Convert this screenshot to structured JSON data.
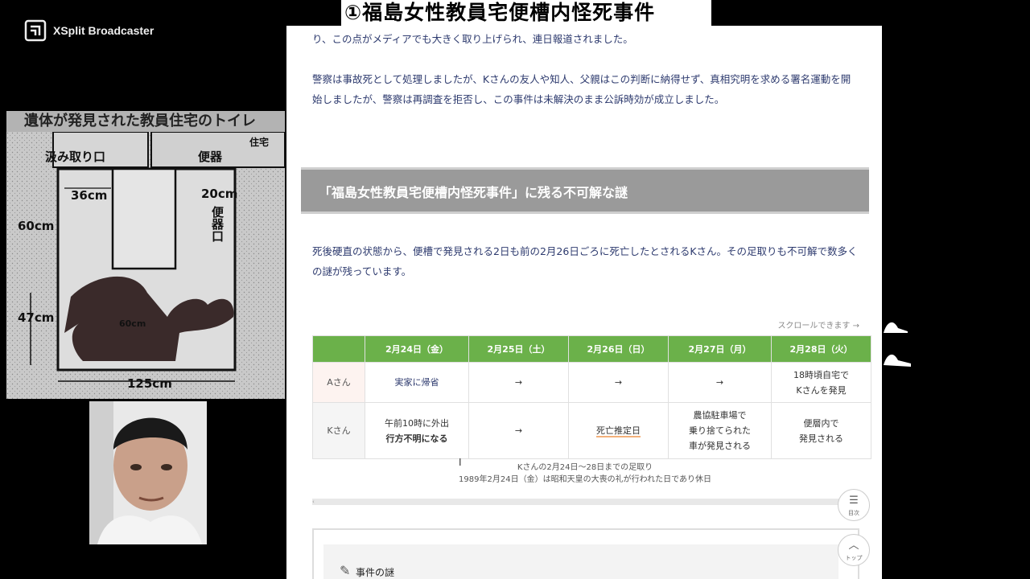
{
  "banner": {
    "title": "①福島女性教員宅便槽内怪死事件"
  },
  "xsplit": {
    "name": "XSplit Broadcaster"
  },
  "plan": {
    "header": "遺体が発見された教員住宅のトイレ",
    "labels": {
      "kumitori": "汲み取り口",
      "benki": "便器",
      "jutaku": "住宅",
      "w36": "36cm",
      "w20": "20cm",
      "benkiguchi": "便器口",
      "h60": "60cm",
      "h47": "47cm",
      "w125": "125cm",
      "w60": "60cm"
    }
  },
  "page": {
    "para1": "り、この点がメディアでも大きく取り上げられ、連日報道されました。",
    "para2": "警察は事故死として処理しましたが、Kさんの友人や知人、父親はこの判断に納得せず、真相究明を求める署名運動を開始しましたが、警察は再調査を拒否し、この事件は未解決のまま公訴時効が成立しました。",
    "heading": "「福島女性教員宅便槽内怪死事件」に残る不可解な謎",
    "para3": "死後硬直の状態から、便槽で発見される2日も前の2月26日ごろに死亡したとされるKさん。その足取りも不可解で数多くの謎が残っています。",
    "scroll_hint": "スクロールできます →",
    "table": {
      "headers": [
        "",
        "2月24日（金）",
        "2月25日（土）",
        "2月26日（日）",
        "2月27日（月）",
        "2月28日（火）"
      ],
      "rows": [
        {
          "label": "Aさん",
          "cells": [
            "実家に帰省",
            "→",
            "→",
            "→",
            "18時頃自宅で\nKさんを発見"
          ]
        },
        {
          "label": "Kさん",
          "cells": [
            "午前10時に外出",
            "→",
            "死亡推定日",
            "農協駐車場で\n乗り捨てられた\n車が発見される",
            "便層内で\n発見される"
          ],
          "bold_line": "行方不明になる"
        }
      ]
    },
    "caption1": "Kさんの2月24日〜28日までの足取り",
    "caption2": "1989年2月24日（金）は昭和天皇の大喪の礼が行われた日であり休日",
    "box_title": "事件の謎",
    "side_toc": "目次",
    "side_top": "トップ"
  }
}
